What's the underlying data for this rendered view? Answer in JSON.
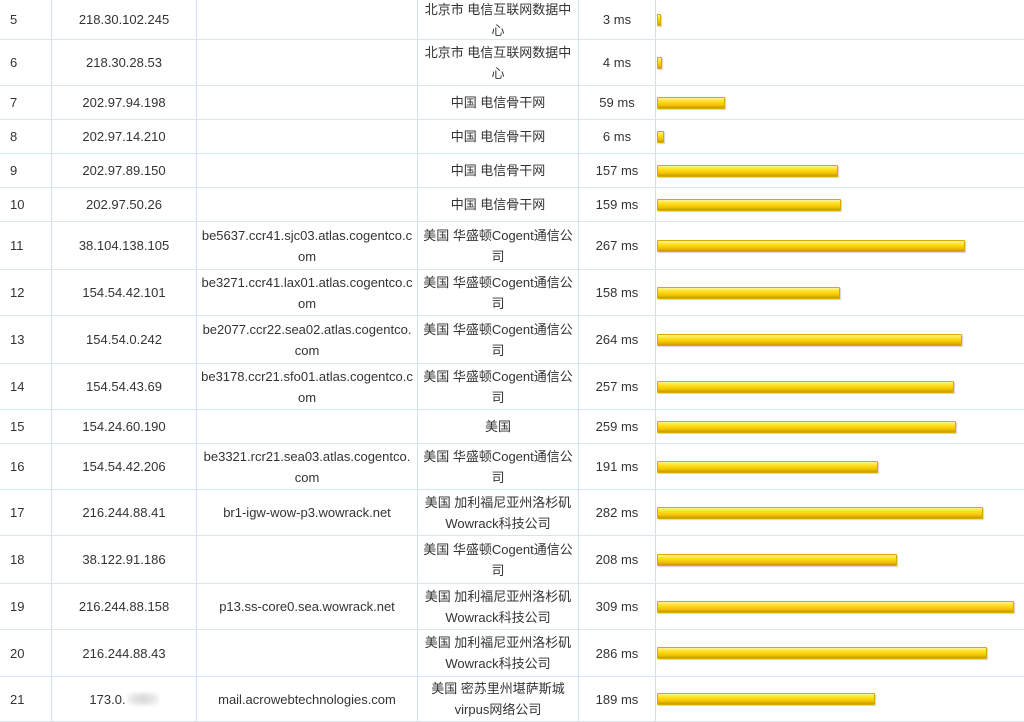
{
  "trace": {
    "max_ms": 309,
    "bar_color": "#ffd800",
    "rows": [
      {
        "hop": "5",
        "ip": "218.30.102.245",
        "host": "",
        "location": "北京市 电信互联网数据中心",
        "time": "3 ms",
        "ms": 3
      },
      {
        "hop": "6",
        "ip": "218.30.28.53",
        "host": "",
        "location": "北京市 电信互联网数据中心",
        "time": "4 ms",
        "ms": 4
      },
      {
        "hop": "7",
        "ip": "202.97.94.198",
        "host": "",
        "location": "中国 电信骨干网",
        "time": "59 ms",
        "ms": 59
      },
      {
        "hop": "8",
        "ip": "202.97.14.210",
        "host": "",
        "location": "中国 电信骨干网",
        "time": "6 ms",
        "ms": 6
      },
      {
        "hop": "9",
        "ip": "202.97.89.150",
        "host": "",
        "location": "中国 电信骨干网",
        "time": "157 ms",
        "ms": 157
      },
      {
        "hop": "10",
        "ip": "202.97.50.26",
        "host": "",
        "location": "中国 电信骨干网",
        "time": "159 ms",
        "ms": 159
      },
      {
        "hop": "11",
        "ip": "38.104.138.105",
        "host": "be5637.ccr41.sjc03.atlas.cogentco.com",
        "location": "美国 华盛顿Cogent通信公司",
        "time": "267 ms",
        "ms": 267
      },
      {
        "hop": "12",
        "ip": "154.54.42.101",
        "host": "be3271.ccr41.lax01.atlas.cogentco.com",
        "location": "美国 华盛顿Cogent通信公司",
        "time": "158 ms",
        "ms": 158
      },
      {
        "hop": "13",
        "ip": "154.54.0.242",
        "host": "be2077.ccr22.sea02.atlas.cogentco.com",
        "location": "美国 华盛顿Cogent通信公司",
        "time": "264 ms",
        "ms": 264
      },
      {
        "hop": "14",
        "ip": "154.54.43.69",
        "host": "be3178.ccr21.sfo01.atlas.cogentco.com",
        "location": "美国 华盛顿Cogent通信公司",
        "time": "257 ms",
        "ms": 257
      },
      {
        "hop": "15",
        "ip": "154.24.60.190",
        "host": "",
        "location": "美国",
        "time": "259 ms",
        "ms": 259
      },
      {
        "hop": "16",
        "ip": "154.54.42.206",
        "host": "be3321.rcr21.sea03.atlas.cogentco.com",
        "location": "美国 华盛顿Cogent通信公司",
        "time": "191 ms",
        "ms": 191
      },
      {
        "hop": "17",
        "ip": "216.244.88.41",
        "host": "br1-igw-wow-p3.wowrack.net",
        "location": "美国 加利福尼亚州洛杉矶Wowrack科技公司",
        "time": "282 ms",
        "ms": 282
      },
      {
        "hop": "18",
        "ip": "38.122.91.186",
        "host": "",
        "location": "美国 华盛顿Cogent通信公司",
        "time": "208 ms",
        "ms": 208
      },
      {
        "hop": "19",
        "ip": "216.244.88.158",
        "host": "p13.ss-core0.sea.wowrack.net",
        "location": "美国 加利福尼亚州洛杉矶Wowrack科技公司",
        "time": "309 ms",
        "ms": 309
      },
      {
        "hop": "20",
        "ip": "216.244.88.43",
        "host": "",
        "location": "美国 加利福尼亚州洛杉矶Wowrack科技公司",
        "time": "286 ms",
        "ms": 286
      },
      {
        "hop": "21",
        "ip": "173.0.",
        "host": "mail.acrowebtechnologies.com",
        "location": "美国 密苏里州堪萨斯城virpus网络公司",
        "time": "189 ms",
        "ms": 189,
        "redacted": true
      }
    ]
  }
}
